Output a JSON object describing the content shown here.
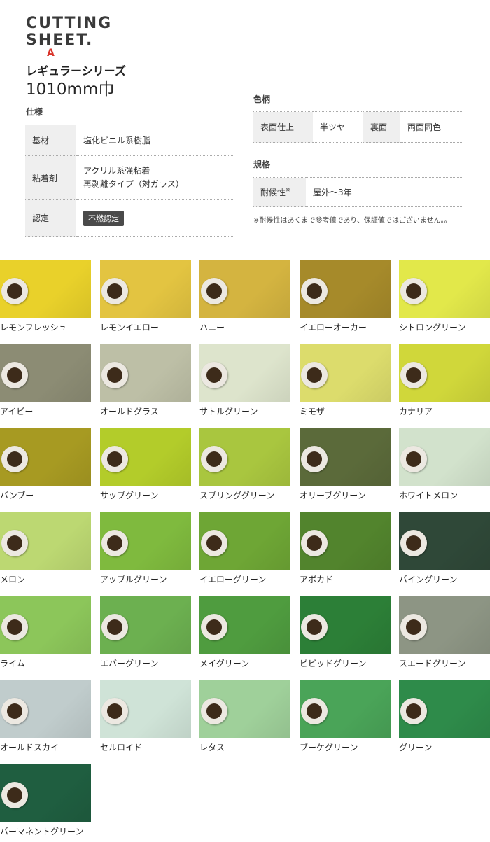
{
  "header": {
    "logo_line1": "CUTTING",
    "logo_line2": "SHEET.",
    "logo_mark": "A",
    "series_name": "レギュラーシリーズ",
    "width": "1010mm巾"
  },
  "spec": {
    "title": "仕様",
    "rows": [
      {
        "label": "基材",
        "value": "塩化ビニル系樹脂"
      },
      {
        "label": "粘着剤",
        "value_line1": "アクリル系強粘着",
        "value_line2": "再剥離タイプ（対ガラス）"
      },
      {
        "label": "認定",
        "badge": "不燃認定"
      }
    ]
  },
  "pattern": {
    "title": "色柄",
    "front_label": "表面仕上",
    "front_value": "半ツヤ",
    "back_label": "裏面",
    "back_value": "両面同色"
  },
  "standard": {
    "title": "規格",
    "label": "耐候性",
    "label_mark": "※",
    "value": "屋外～3年",
    "note": "※耐候性はあくまで参考値であり、保証値ではございません。。"
  },
  "colors": [
    {
      "name": "レモンフレッシュ",
      "hex": "#e9d12a"
    },
    {
      "name": "レモンイエロー",
      "hex": "#e3c441"
    },
    {
      "name": "ハニー",
      "hex": "#d4b440"
    },
    {
      "name": "イエローオーカー",
      "hex": "#a68a2a"
    },
    {
      "name": "シトロングリーン",
      "hex": "#e2e84a"
    },
    {
      "name": "アイビー",
      "hex": "#8c8c74"
    },
    {
      "name": "オールドグラス",
      "hex": "#bdbfa6"
    },
    {
      "name": "サトルグリーン",
      "hex": "#dde4cc"
    },
    {
      "name": "ミモザ",
      "hex": "#dcdc6c"
    },
    {
      "name": "カナリア",
      "hex": "#d0d73a"
    },
    {
      "name": "バンブー",
      "hex": "#a79a22"
    },
    {
      "name": "サップグリーン",
      "hex": "#b3cc2a"
    },
    {
      "name": "スプリンググリーン",
      "hex": "#a9c63f"
    },
    {
      "name": "オリーブグリーン",
      "hex": "#5b6a3a"
    },
    {
      "name": "ホワイトメロン",
      "hex": "#d2e2cc"
    },
    {
      "name": "メロン",
      "hex": "#bcd872"
    },
    {
      "name": "アップルグリーン",
      "hex": "#7fba3e"
    },
    {
      "name": "イエローグリーン",
      "hex": "#6ea635"
    },
    {
      "name": "アボカド",
      "hex": "#52842d"
    },
    {
      "name": "パイングリーン",
      "hex": "#2f4838"
    },
    {
      "name": "ライム",
      "hex": "#8cc65a"
    },
    {
      "name": "エバーグリーン",
      "hex": "#6cb050"
    },
    {
      "name": "メイグリーン",
      "hex": "#4f9c3f"
    },
    {
      "name": "ビビッドグリーン",
      "hex": "#2c7f37"
    },
    {
      "name": "スエードグリーン",
      "hex": "#8d9584"
    },
    {
      "name": "オールドスカイ",
      "hex": "#c0cccc"
    },
    {
      "name": "セルロイド",
      "hex": "#cfe3d7"
    },
    {
      "name": "レタス",
      "hex": "#9fd09a"
    },
    {
      "name": "ブーケグリーン",
      "hex": "#4aa458"
    },
    {
      "name": "グリーン",
      "hex": "#2e8b4a"
    },
    {
      "name": "パーマネントグリーン",
      "hex": "#1f5e40"
    }
  ]
}
